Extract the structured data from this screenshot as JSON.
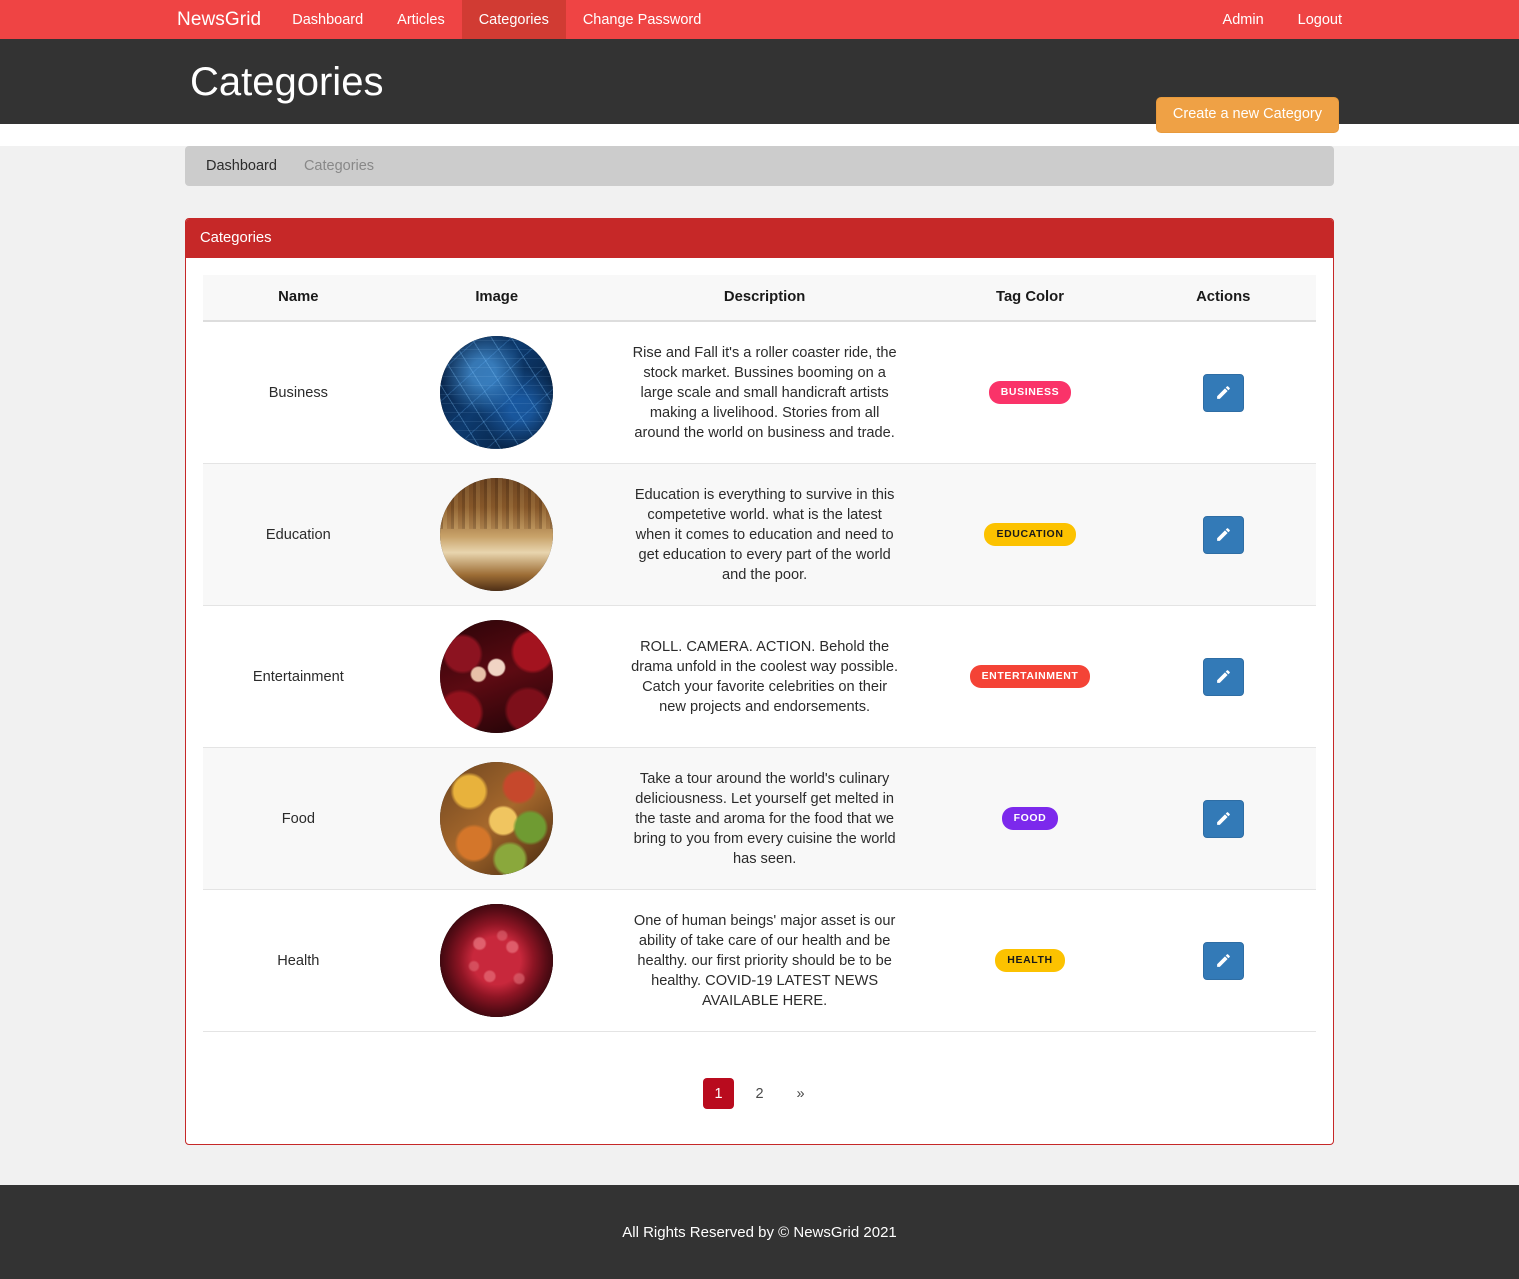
{
  "navbar": {
    "brand": "NewsGrid",
    "items": [
      {
        "label": "Dashboard",
        "active": false
      },
      {
        "label": "Articles",
        "active": false
      },
      {
        "label": "Categories",
        "active": true
      },
      {
        "label": "Change Password",
        "active": false
      }
    ],
    "right_items": [
      {
        "label": "Admin"
      },
      {
        "label": "Logout"
      }
    ],
    "background_color": "#ef4444",
    "active_color": "#d13b33"
  },
  "header": {
    "title": "Categories",
    "create_button": "Create a new Category",
    "create_button_color": "#efa145",
    "background_color": "#333333"
  },
  "breadcrumb": {
    "items": [
      {
        "label": "Dashboard",
        "current": false
      },
      {
        "label": "Categories",
        "current": true
      }
    ]
  },
  "panel": {
    "heading": "Categories",
    "heading_color": "#c62828"
  },
  "table": {
    "columns": [
      "Name",
      "Image",
      "Description",
      "Tag Color",
      "Actions"
    ],
    "rows": [
      {
        "name": "Business",
        "image_alt": "business-stock-market-thumbnail",
        "description": "Rise and Fall it's a roller coaster ride, the stock market. Bussines booming on a large scale and small handicraft artists making a livelihood. Stories from all around the world on business and trade.",
        "tag_label": "BUSINESS",
        "tag_color": "#fa3369",
        "tag_text_color": "#ffffff",
        "action_icon": "pencil-icon"
      },
      {
        "name": "Education",
        "image_alt": "education-books-thumbnail",
        "description": "Education is everything to survive in this competetive world. what is the latest when it comes to education and need to get education to every part of the world and the poor.",
        "tag_label": "EDUCATION",
        "tag_color": "#fcc200",
        "tag_text_color": "#1a1a1a",
        "action_icon": "pencil-icon"
      },
      {
        "name": "Entertainment",
        "image_alt": "entertainment-celebrities-thumbnail",
        "description": "ROLL. CAMERA. ACTION. Behold the drama unfold in the coolest way possible. Catch your favorite celebrities on their new projects and endorsements.",
        "tag_label": "ENTERTAINMENT",
        "tag_color": "#f44336",
        "tag_text_color": "#ffffff",
        "action_icon": "pencil-icon"
      },
      {
        "name": "Food",
        "image_alt": "food-cuisine-thumbnail",
        "description": "Take a tour around the world's culinary deliciousness. Let yourself get melted in the taste and aroma for the food that we bring to you from every cuisine the world has seen.",
        "tag_label": "FOOD",
        "tag_color": "#7c29ec",
        "tag_text_color": "#ffffff",
        "action_icon": "pencil-icon"
      },
      {
        "name": "Health",
        "image_alt": "health-virus-thumbnail",
        "description": "One of human beings' major asset is our ability of take care of our health and be healthy. our first priority should be to be healthy. COVID-19 LATEST NEWS AVAILABLE HERE.",
        "tag_label": "HEALTH",
        "tag_color": "#fcc200",
        "tag_text_color": "#1a1a1a",
        "action_icon": "pencil-icon"
      }
    ]
  },
  "pagination": {
    "pages": [
      {
        "label": "1",
        "active": true
      },
      {
        "label": "2",
        "active": false
      },
      {
        "label": "»",
        "active": false
      }
    ],
    "active_color": "#b90b1e"
  },
  "footer": {
    "text": "All Rights Reserved by © NewsGrid 2021"
  }
}
